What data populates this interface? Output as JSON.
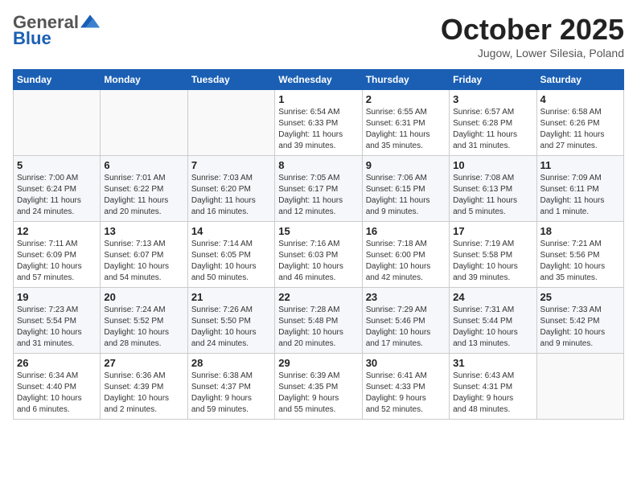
{
  "header": {
    "logo_general": "General",
    "logo_blue": "Blue",
    "month_title": "October 2025",
    "location": "Jugow, Lower Silesia, Poland"
  },
  "weekdays": [
    "Sunday",
    "Monday",
    "Tuesday",
    "Wednesday",
    "Thursday",
    "Friday",
    "Saturday"
  ],
  "weeks": [
    [
      {
        "day": "",
        "info": ""
      },
      {
        "day": "",
        "info": ""
      },
      {
        "day": "",
        "info": ""
      },
      {
        "day": "1",
        "info": "Sunrise: 6:54 AM\nSunset: 6:33 PM\nDaylight: 11 hours\nand 39 minutes."
      },
      {
        "day": "2",
        "info": "Sunrise: 6:55 AM\nSunset: 6:31 PM\nDaylight: 11 hours\nand 35 minutes."
      },
      {
        "day": "3",
        "info": "Sunrise: 6:57 AM\nSunset: 6:28 PM\nDaylight: 11 hours\nand 31 minutes."
      },
      {
        "day": "4",
        "info": "Sunrise: 6:58 AM\nSunset: 6:26 PM\nDaylight: 11 hours\nand 27 minutes."
      }
    ],
    [
      {
        "day": "5",
        "info": "Sunrise: 7:00 AM\nSunset: 6:24 PM\nDaylight: 11 hours\nand 24 minutes."
      },
      {
        "day": "6",
        "info": "Sunrise: 7:01 AM\nSunset: 6:22 PM\nDaylight: 11 hours\nand 20 minutes."
      },
      {
        "day": "7",
        "info": "Sunrise: 7:03 AM\nSunset: 6:20 PM\nDaylight: 11 hours\nand 16 minutes."
      },
      {
        "day": "8",
        "info": "Sunrise: 7:05 AM\nSunset: 6:17 PM\nDaylight: 11 hours\nand 12 minutes."
      },
      {
        "day": "9",
        "info": "Sunrise: 7:06 AM\nSunset: 6:15 PM\nDaylight: 11 hours\nand 9 minutes."
      },
      {
        "day": "10",
        "info": "Sunrise: 7:08 AM\nSunset: 6:13 PM\nDaylight: 11 hours\nand 5 minutes."
      },
      {
        "day": "11",
        "info": "Sunrise: 7:09 AM\nSunset: 6:11 PM\nDaylight: 11 hours\nand 1 minute."
      }
    ],
    [
      {
        "day": "12",
        "info": "Sunrise: 7:11 AM\nSunset: 6:09 PM\nDaylight: 10 hours\nand 57 minutes."
      },
      {
        "day": "13",
        "info": "Sunrise: 7:13 AM\nSunset: 6:07 PM\nDaylight: 10 hours\nand 54 minutes."
      },
      {
        "day": "14",
        "info": "Sunrise: 7:14 AM\nSunset: 6:05 PM\nDaylight: 10 hours\nand 50 minutes."
      },
      {
        "day": "15",
        "info": "Sunrise: 7:16 AM\nSunset: 6:03 PM\nDaylight: 10 hours\nand 46 minutes."
      },
      {
        "day": "16",
        "info": "Sunrise: 7:18 AM\nSunset: 6:00 PM\nDaylight: 10 hours\nand 42 minutes."
      },
      {
        "day": "17",
        "info": "Sunrise: 7:19 AM\nSunset: 5:58 PM\nDaylight: 10 hours\nand 39 minutes."
      },
      {
        "day": "18",
        "info": "Sunrise: 7:21 AM\nSunset: 5:56 PM\nDaylight: 10 hours\nand 35 minutes."
      }
    ],
    [
      {
        "day": "19",
        "info": "Sunrise: 7:23 AM\nSunset: 5:54 PM\nDaylight: 10 hours\nand 31 minutes."
      },
      {
        "day": "20",
        "info": "Sunrise: 7:24 AM\nSunset: 5:52 PM\nDaylight: 10 hours\nand 28 minutes."
      },
      {
        "day": "21",
        "info": "Sunrise: 7:26 AM\nSunset: 5:50 PM\nDaylight: 10 hours\nand 24 minutes."
      },
      {
        "day": "22",
        "info": "Sunrise: 7:28 AM\nSunset: 5:48 PM\nDaylight: 10 hours\nand 20 minutes."
      },
      {
        "day": "23",
        "info": "Sunrise: 7:29 AM\nSunset: 5:46 PM\nDaylight: 10 hours\nand 17 minutes."
      },
      {
        "day": "24",
        "info": "Sunrise: 7:31 AM\nSunset: 5:44 PM\nDaylight: 10 hours\nand 13 minutes."
      },
      {
        "day": "25",
        "info": "Sunrise: 7:33 AM\nSunset: 5:42 PM\nDaylight: 10 hours\nand 9 minutes."
      }
    ],
    [
      {
        "day": "26",
        "info": "Sunrise: 6:34 AM\nSunset: 4:40 PM\nDaylight: 10 hours\nand 6 minutes."
      },
      {
        "day": "27",
        "info": "Sunrise: 6:36 AM\nSunset: 4:39 PM\nDaylight: 10 hours\nand 2 minutes."
      },
      {
        "day": "28",
        "info": "Sunrise: 6:38 AM\nSunset: 4:37 PM\nDaylight: 9 hours\nand 59 minutes."
      },
      {
        "day": "29",
        "info": "Sunrise: 6:39 AM\nSunset: 4:35 PM\nDaylight: 9 hours\nand 55 minutes."
      },
      {
        "day": "30",
        "info": "Sunrise: 6:41 AM\nSunset: 4:33 PM\nDaylight: 9 hours\nand 52 minutes."
      },
      {
        "day": "31",
        "info": "Sunrise: 6:43 AM\nSunset: 4:31 PM\nDaylight: 9 hours\nand 48 minutes."
      },
      {
        "day": "",
        "info": ""
      }
    ]
  ]
}
